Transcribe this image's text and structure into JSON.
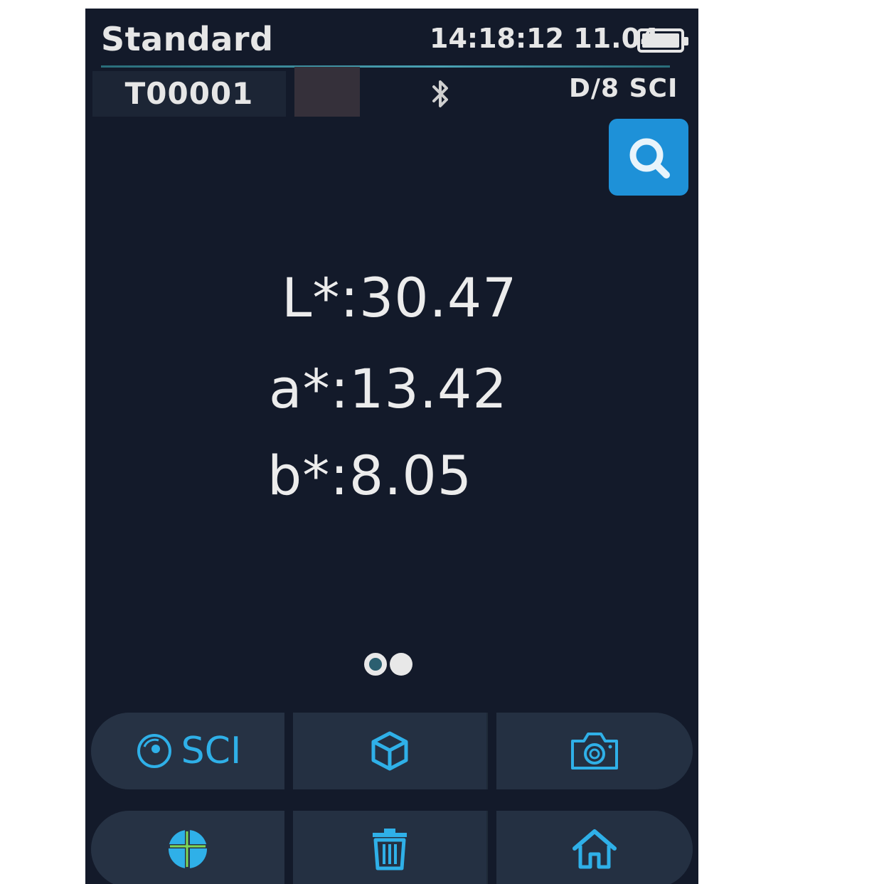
{
  "status_bar": {
    "mode": "Standard",
    "clock": "14:18:12 11.04"
  },
  "sample_bar": {
    "sample_id": "T00001",
    "geometry": "D/8 SCI",
    "swatch_color": "#35303a"
  },
  "readings": {
    "L": "L*:30.47",
    "a": "a*:13.42",
    "b": "b*:8.05"
  },
  "pager": {
    "pages": 2,
    "active": 1
  },
  "toolbar": {
    "row1": {
      "sci_label": "SCI"
    }
  },
  "icons": {
    "search": "search-icon",
    "bluetooth": "bluetooth-icon",
    "battery": "battery-icon",
    "sci": "target-icon",
    "cube": "cube-icon",
    "camera": "camera-icon",
    "grid": "grid-globe-icon",
    "trash": "trash-icon",
    "home": "home-icon"
  },
  "colors": {
    "accent": "#1e91d8",
    "icon": "#2fb0e8",
    "background": "#131a2a"
  }
}
